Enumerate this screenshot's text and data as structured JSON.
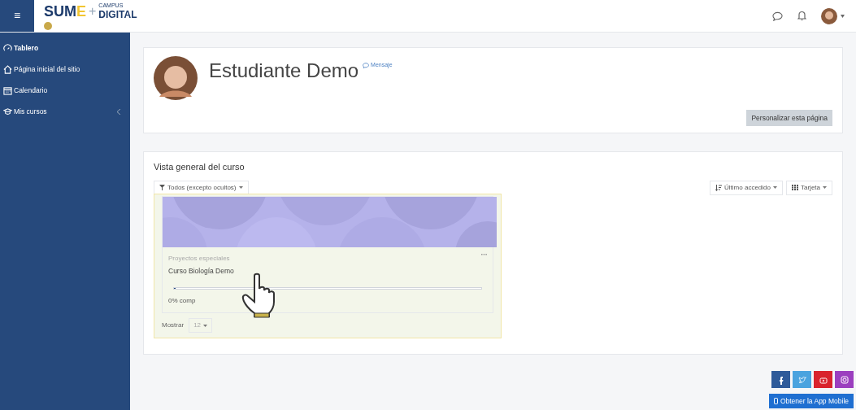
{
  "navbar": {
    "menu_icon": "≡",
    "logo": {
      "brand": "SUM",
      "brand_accent": "E",
      "plus": "+",
      "small": "CAMPUS",
      "digital": "DIGITAL"
    }
  },
  "sidebar": {
    "items": [
      {
        "label": "Tablero",
        "selected": true
      },
      {
        "label": "Página inicial del sitio",
        "selected": false
      },
      {
        "label": "Calendario",
        "selected": false
      },
      {
        "label": "Mis cursos",
        "selected": false
      }
    ]
  },
  "profile": {
    "name": "Estudiante Demo",
    "message_link": "Mensaje",
    "customize_button": "Personalizar esta página"
  },
  "course_overview": {
    "title": "Vista general del curso",
    "filter": "Todos (excepto ocultos)",
    "sort": "Último accedido",
    "view": "Tarjeta",
    "courses": [
      {
        "category": "Proyectos especiales",
        "name": "Curso Biología Demo",
        "level": 0,
        "progress_text": "0% comp"
      }
    ],
    "show_label": "Mostrar",
    "show_value": "12"
  },
  "social": [
    {
      "kind": "facebook",
      "color": "#2f5b9a"
    },
    {
      "kind": "twitter",
      "color": "#4aa3df"
    },
    {
      "kind": "youtube",
      "color": "#d9232d"
    },
    {
      "kind": "instagram",
      "color": "#9b3fbf"
    }
  ],
  "app_button": "Obtener la App Mobile"
}
